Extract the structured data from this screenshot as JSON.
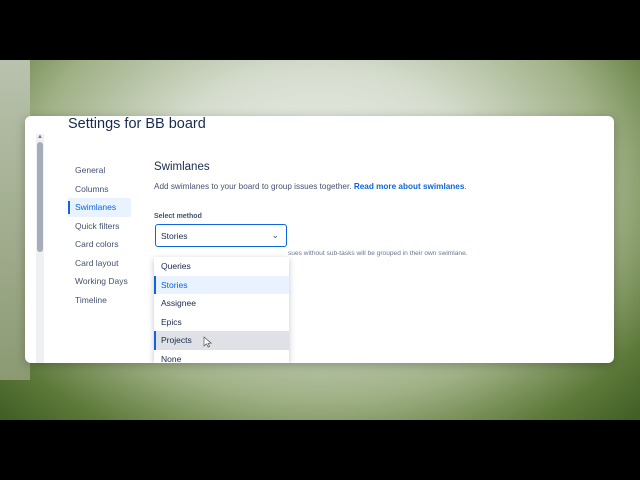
{
  "page": {
    "title": "Settings for BB board"
  },
  "sidebar": {
    "items": [
      {
        "label": "General"
      },
      {
        "label": "Columns"
      },
      {
        "label": "Swimlanes"
      },
      {
        "label": "Quick filters"
      },
      {
        "label": "Card colors"
      },
      {
        "label": "Card layout"
      },
      {
        "label": "Working Days"
      },
      {
        "label": "Timeline"
      }
    ],
    "active": "Swimlanes"
  },
  "main": {
    "section_title": "Swimlanes",
    "description": "Add swimlanes to your board to group issues together.",
    "read_more_link": "Read more about swimlanes",
    "description_end": ".",
    "select_label": "Select method",
    "select_value": "Stories",
    "helper_text": "sues without sub-tasks will be grouped in their own swimlane.",
    "options": [
      {
        "label": "Queries"
      },
      {
        "label": "Stories"
      },
      {
        "label": "Assignee"
      },
      {
        "label": "Epics"
      },
      {
        "label": "Projects"
      },
      {
        "label": "None"
      }
    ],
    "selected_option": "Stories",
    "hovered_option": "Projects"
  },
  "icons": {
    "select_chevron": "chevron-down-icon",
    "scroll_up": "scroll-up-arrow-icon",
    "cursor": "mouse-pointer-icon"
  },
  "colors": {
    "accent": "#0c66e4",
    "text": "#172b4d",
    "subtle_text": "#42526e",
    "selected_bg": "#e9f2ff",
    "hover_bg": "#dfe1e6"
  }
}
